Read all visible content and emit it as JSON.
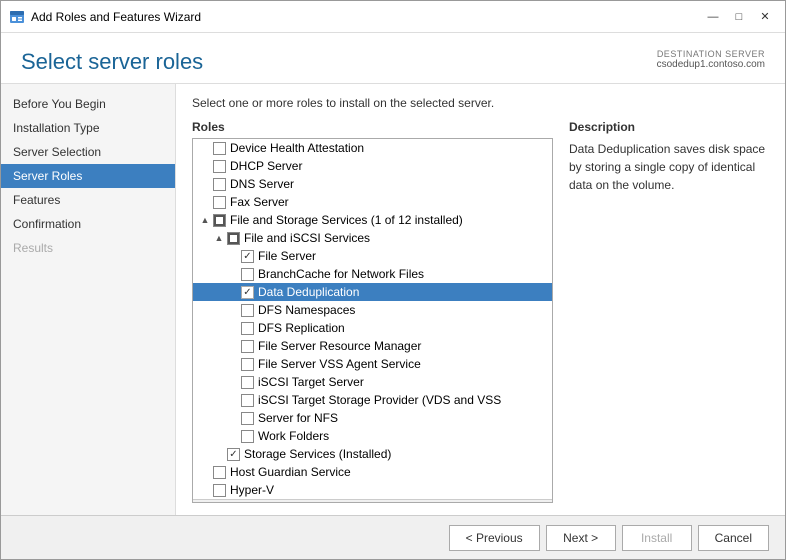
{
  "window": {
    "title": "Add Roles and Features Wizard",
    "controls": {
      "minimize": "—",
      "maximize": "□",
      "close": "✕"
    }
  },
  "header": {
    "page_title": "Select server roles",
    "destination_label": "DESTINATION SERVER",
    "destination_server": "csodedup1.contoso.com",
    "instruction": "Select one or more roles to install on the selected server."
  },
  "sidebar": {
    "items": [
      {
        "label": "Before You Begin",
        "state": "normal"
      },
      {
        "label": "Installation Type",
        "state": "normal"
      },
      {
        "label": "Server Selection",
        "state": "normal"
      },
      {
        "label": "Server Roles",
        "state": "active"
      },
      {
        "label": "Features",
        "state": "normal"
      },
      {
        "label": "Confirmation",
        "state": "normal"
      },
      {
        "label": "Results",
        "state": "disabled"
      }
    ]
  },
  "roles_panel": {
    "header": "Roles",
    "items": [
      {
        "label": "Device Health Attestation",
        "indent": 1,
        "checked": false,
        "expand": false,
        "selected": false
      },
      {
        "label": "DHCP Server",
        "indent": 1,
        "checked": false,
        "expand": false,
        "selected": false
      },
      {
        "label": "DNS Server",
        "indent": 1,
        "checked": false,
        "expand": false,
        "selected": false
      },
      {
        "label": "Fax Server",
        "indent": 1,
        "checked": false,
        "expand": false,
        "selected": false
      },
      {
        "label": "File and Storage Services (1 of 12 installed)",
        "indent": 1,
        "checked": true,
        "square": true,
        "expand": true,
        "expanded": true,
        "selected": false
      },
      {
        "label": "File and iSCSI Services",
        "indent": 2,
        "checked": true,
        "square": true,
        "expand": true,
        "expanded": true,
        "selected": false
      },
      {
        "label": "File Server",
        "indent": 3,
        "checked": true,
        "expand": false,
        "selected": false
      },
      {
        "label": "BranchCache for Network Files",
        "indent": 3,
        "checked": false,
        "expand": false,
        "selected": false
      },
      {
        "label": "Data Deduplication",
        "indent": 3,
        "checked": true,
        "expand": false,
        "selected": true
      },
      {
        "label": "DFS Namespaces",
        "indent": 3,
        "checked": false,
        "expand": false,
        "selected": false
      },
      {
        "label": "DFS Replication",
        "indent": 3,
        "checked": false,
        "expand": false,
        "selected": false
      },
      {
        "label": "File Server Resource Manager",
        "indent": 3,
        "checked": false,
        "expand": false,
        "selected": false
      },
      {
        "label": "File Server VSS Agent Service",
        "indent": 3,
        "checked": false,
        "expand": false,
        "selected": false
      },
      {
        "label": "iSCSI Target Server",
        "indent": 3,
        "checked": false,
        "expand": false,
        "selected": false
      },
      {
        "label": "iSCSI Target Storage Provider (VDS and VSS)",
        "indent": 3,
        "checked": false,
        "expand": false,
        "selected": false
      },
      {
        "label": "Server for NFS",
        "indent": 3,
        "checked": false,
        "expand": false,
        "selected": false
      },
      {
        "label": "Work Folders",
        "indent": 3,
        "checked": false,
        "expand": false,
        "selected": false
      },
      {
        "label": "Storage Services (Installed)",
        "indent": 2,
        "checked": true,
        "square": false,
        "expand": false,
        "selected": false
      },
      {
        "label": "Host Guardian Service",
        "indent": 1,
        "checked": false,
        "expand": false,
        "selected": false
      },
      {
        "label": "Hyper-V",
        "indent": 1,
        "checked": false,
        "expand": false,
        "selected": false
      }
    ]
  },
  "description_panel": {
    "header": "Description",
    "text": "Data Deduplication saves disk space by storing a single copy of identical data on the volume."
  },
  "footer": {
    "previous_label": "< Previous",
    "next_label": "Next >",
    "install_label": "Install",
    "cancel_label": "Cancel"
  }
}
